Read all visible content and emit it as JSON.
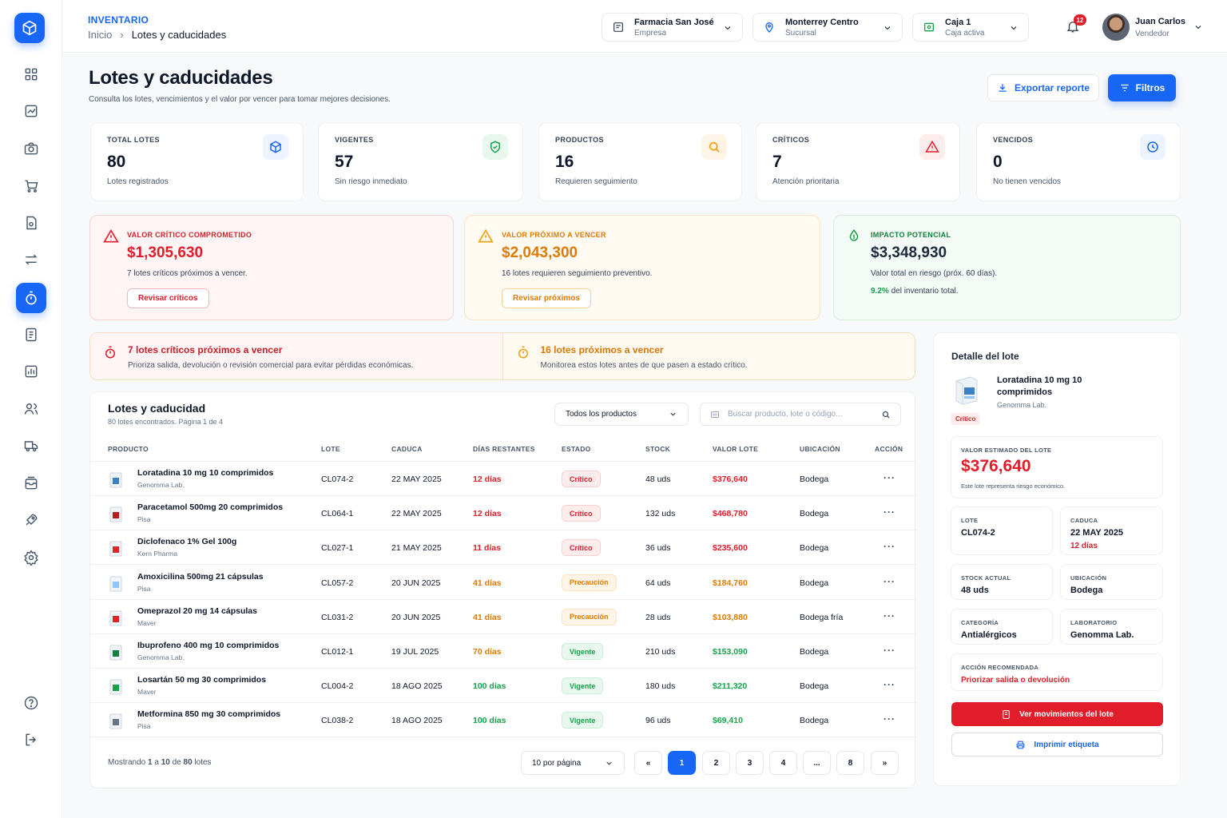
{
  "header": {
    "section": "INVENTARIO",
    "breadcrumb_home": "Inicio",
    "breadcrumb_current": "Lotes y caducidades",
    "company": {
      "name": "Farmacia San José",
      "sub": "Empresa"
    },
    "branch": {
      "name": "Monterrey Centro",
      "sub": "Sucursal"
    },
    "register": {
      "name": "Caja 1",
      "sub": "Caja activa"
    },
    "notifications": "12",
    "user": {
      "name": "Juan Carlos",
      "role": "Vendedor"
    }
  },
  "page": {
    "title": "Lotes y caducidades",
    "subtitle": "Consulta los lotes, vencimientos y el valor por vencer para tomar mejores decisiones.",
    "export_label": "Exportar reporte",
    "filter_label": "Filtros"
  },
  "kpis": [
    {
      "label": "TOTAL LOTES",
      "value": "80",
      "desc": "Lotes registrados",
      "color": "#1766f5"
    },
    {
      "label": "VIGENTES",
      "value": "57",
      "desc": "Sin riesgo inmediato",
      "color": "#16a34a"
    },
    {
      "label": "PRODUCTOS",
      "value": "16",
      "desc": "Requieren seguimiento",
      "color": "#f59e0b"
    },
    {
      "label": "CRÍTICOS",
      "value": "7",
      "desc": "Atención prioritaria",
      "color": "#e11d2a"
    },
    {
      "label": "VENCIDOS",
      "value": "0",
      "desc": "No tienen vencidos",
      "color": "#1766f5"
    }
  ],
  "values": {
    "critical": {
      "label": "VALOR CRÍTICO COMPROMETIDO",
      "value": "$1,305,630",
      "desc": "7 lotes críticos próximos a vencer.",
      "button": "Revisar críticos"
    },
    "upcoming": {
      "label": "VALOR PRÓXIMO A VENCER",
      "value": "$2,043,300",
      "desc": "16 lotes requieren seguimiento preventivo.",
      "button": "Revisar próximos"
    },
    "impact": {
      "label": "IMPACTO POTENCIAL",
      "value": "$3,348,930",
      "desc": "Valor total en riesgo (próx. 60 días).",
      "pct": "9.2%",
      "pct_desc": "del inventario total."
    }
  },
  "alerts": {
    "critical": {
      "title": "7 lotes críticos próximos a vencer",
      "desc": "Prioriza salida, devolución o revisión comercial para evitar pérdidas económicas."
    },
    "upcoming": {
      "title": "16 lotes próximos a vencer",
      "desc": "Monitorea estos lotes antes de que pasen a estado crítico."
    }
  },
  "table": {
    "title": "Lotes y caducidad",
    "subtitle": "80 lotes encontrados. Página 1 de 4",
    "filter_value": "Todos los productos",
    "search_placeholder": "Buscar producto, lote o código...",
    "columns": [
      "PRODUCTO",
      "LOTE",
      "CADUCA",
      "DÍAS RESTANTES",
      "ESTADO",
      "STOCK",
      "VALOR LOTE",
      "UBICACIÓN",
      "ACCIÓN"
    ],
    "rows": [
      {
        "name": "Loratadina 10 mg 10 comprimidos",
        "lab": "Genomma Lab.",
        "lot": "CL074-2",
        "expires": "22 MAY 2025",
        "days": "12 días",
        "status": "Crítico",
        "stock": "48 uds",
        "value": "$376,640",
        "location": "Bodega",
        "tone": "critico",
        "img": "#3b82c4"
      },
      {
        "name": "Paracetamol 500mg 20 comprimidos",
        "lab": "Pisa",
        "lot": "CL064-1",
        "expires": "22 MAY 2025",
        "days": "12 días",
        "status": "Crítico",
        "stock": "132 uds",
        "value": "$468,780",
        "location": "Bodega",
        "tone": "critico",
        "img": "#b91c1c"
      },
      {
        "name": "Diclofenaco 1% Gel 100g",
        "lab": "Kern Pharma",
        "lot": "CL027-1",
        "expires": "21 MAY 2025",
        "days": "11 días",
        "status": "Crítico",
        "stock": "36 uds",
        "value": "$235,600",
        "location": "Bodega",
        "tone": "critico",
        "img": "#dc2626"
      },
      {
        "name": "Amoxicilina 500mg 21 cápsulas",
        "lab": "Pisa",
        "lot": "CL057-2",
        "expires": "20 JUN 2025",
        "days": "41 días",
        "status": "Precaución",
        "stock": "64 uds",
        "value": "$184,760",
        "location": "Bodega",
        "tone": "precaucion",
        "img": "#93c5fd"
      },
      {
        "name": "Omeprazol 20 mg 14 cápsulas",
        "lab": "Maver",
        "lot": "CL031-2",
        "expires": "20 JUN 2025",
        "days": "41 días",
        "status": "Precaución",
        "stock": "28 uds",
        "value": "$103,880",
        "location": "Bodega fría",
        "tone": "precaucion",
        "img": "#dc2626"
      },
      {
        "name": "Ibuprofeno 400 mg 10 comprimidos",
        "lab": "Genomma Lab.",
        "lot": "CL012-1",
        "expires": "19 JUL 2025",
        "days": "70 días",
        "status": "Vigente",
        "stock": "210 uds",
        "value": "$153,090",
        "location": "Bodega",
        "tone": "precaucion-days vigente",
        "img": "#15803d"
      },
      {
        "name": "Losartán 50 mg 30 comprimidos",
        "lab": "Maver",
        "lot": "CL004-2",
        "expires": "18 AGO 2025",
        "days": "100 días",
        "status": "Vigente",
        "stock": "180 uds",
        "value": "$211,320",
        "location": "Bodega",
        "tone": "vigente",
        "img": "#16a34a"
      },
      {
        "name": "Metformina 850 mg 30 comprimidos",
        "lab": "Pisa",
        "lot": "CL038-2",
        "expires": "18 AGO 2025",
        "days": "100 días",
        "status": "Vigente",
        "stock": "96 uds",
        "value": "$69,410",
        "location": "Bodega",
        "tone": "vigente",
        "img": "#64748b"
      }
    ],
    "footer": {
      "prefix": "Mostrando",
      "from": "1",
      "mid1": "a",
      "to": "10",
      "mid2": "de",
      "total": "80",
      "suffix": "lotes"
    },
    "per_page": "10 por página",
    "pages": [
      "«",
      "1",
      "2",
      "3",
      "4",
      "...",
      "8",
      "»"
    ]
  },
  "detail": {
    "title": "Detalle del lote",
    "product": "Loratadina 10 mg 10 comprimidos",
    "lab": "Genomma Lab.",
    "badge": "Crítico",
    "est_label": "VALOR ESTIMADO DEL LOTE",
    "est_value": "$376,640",
    "est_note": "Este lote representa riesgo económico.",
    "lot_label": "LOTE",
    "lot": "CL074-2",
    "exp_label": "CADUCA",
    "exp": "22 MAY 2025",
    "exp_days": "12 días",
    "stock_label": "STOCK ACTUAL",
    "stock": "48 uds",
    "loc_label": "UBICACIÓN",
    "loc": "Bodega",
    "cat_label": "CATEGORÍA",
    "cat": "Antialérgicos",
    "lab_label": "LABORATORIO",
    "lab_value": "Genomma Lab.",
    "action_label": "ACCIÓN RECOMENDADA",
    "action": "Priorizar salida o devolución",
    "btn_movements": "Ver movimientos del lote",
    "btn_print": "Imprimir etiqueta"
  },
  "colors": {
    "primary": "#1766f5",
    "danger": "#e11d2a",
    "warning": "#e07a00",
    "success": "#16a34a"
  }
}
